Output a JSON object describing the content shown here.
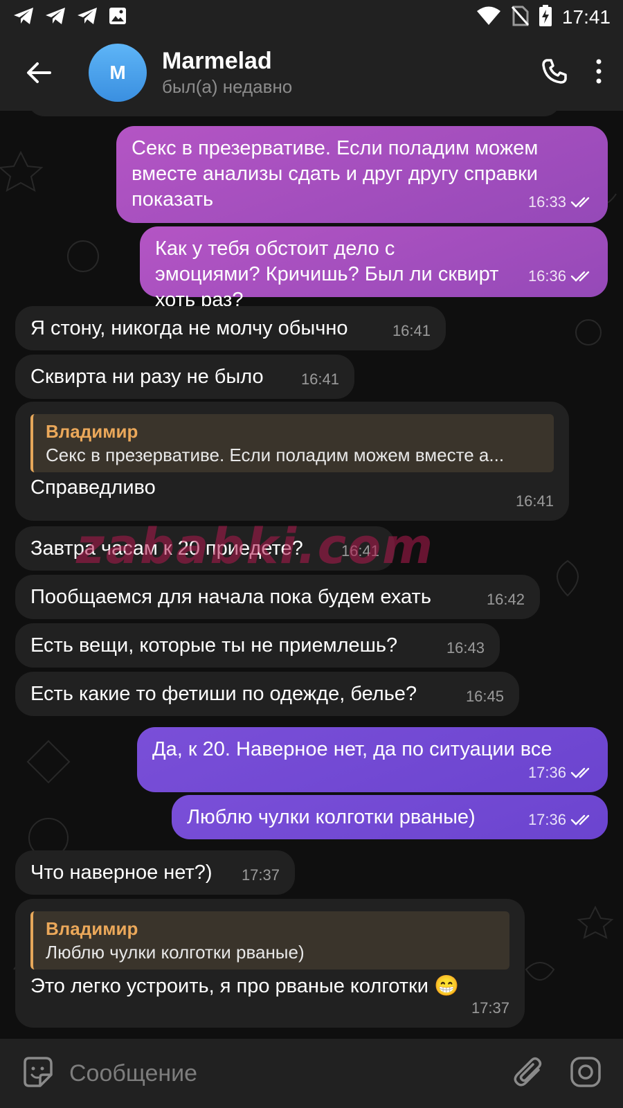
{
  "status_bar": {
    "time": "17:41",
    "notification_icons": [
      "telegram-icon",
      "telegram-icon",
      "telegram-icon",
      "image-icon"
    ],
    "system_icons": [
      "wifi-icon",
      "no-sim-icon",
      "battery-charging-icon"
    ]
  },
  "header": {
    "avatar_initial": "M",
    "name": "Marmelad",
    "status": "был(а) недавно"
  },
  "messages": [
    {
      "direction": "out",
      "text": "Секс в презервативе. Если поладим можем вместе анализы сдать и друг другу справки показать",
      "time": "16:33",
      "read": true
    },
    {
      "direction": "out",
      "text": "Как у тебя обстоит дело с эмоциями? Кричишь? Был ли сквирт хоть раз?",
      "time": "16:36",
      "read": true
    },
    {
      "direction": "in",
      "text": "Я стону, никогда не молчу обычно",
      "time": "16:41"
    },
    {
      "direction": "in",
      "text": "Сквирта ни разу не было",
      "time": "16:41"
    },
    {
      "direction": "in",
      "reply": {
        "author": "Владимир",
        "text": "Секс в презервативе. Если поладим можем вместе а..."
      },
      "text": "Справедливо",
      "time": "16:41"
    },
    {
      "direction": "in",
      "text": "Завтра часам к 20 приедете?",
      "time": "16:41"
    },
    {
      "direction": "in",
      "text": "Пообщаемся для начала пока будем ехать",
      "time": "16:42"
    },
    {
      "direction": "in",
      "text": "Есть вещи, которые ты не приемлешь?",
      "time": "16:43"
    },
    {
      "direction": "in",
      "text": "Есть какие то фетиши по одежде, белье?",
      "time": "16:45"
    },
    {
      "direction": "out",
      "text": "Да, к 20. Наверное нет, да по ситуации все",
      "time": "17:36",
      "read": true
    },
    {
      "direction": "out",
      "text": "Люблю чулки колготки рваные)",
      "time": "17:36",
      "read": true
    },
    {
      "direction": "in",
      "text": "Что наверное нет?)",
      "time": "17:37"
    },
    {
      "direction": "in",
      "reply": {
        "author": "Владимир",
        "text": "Люблю чулки колготки рваные)"
      },
      "text": "Это легко устроить, я про рваные колготки 😁",
      "time": "17:37"
    }
  ],
  "watermark": "zababki.com",
  "input": {
    "placeholder": "Сообщение"
  },
  "colors": {
    "bar": "#212121",
    "incoming_bubble": "#212121",
    "outgoing_pink": "#a450c0",
    "outgoing_purple": "#7049d4",
    "reply_accent": "#e6a75a",
    "avatar": "#4ca2ec"
  }
}
